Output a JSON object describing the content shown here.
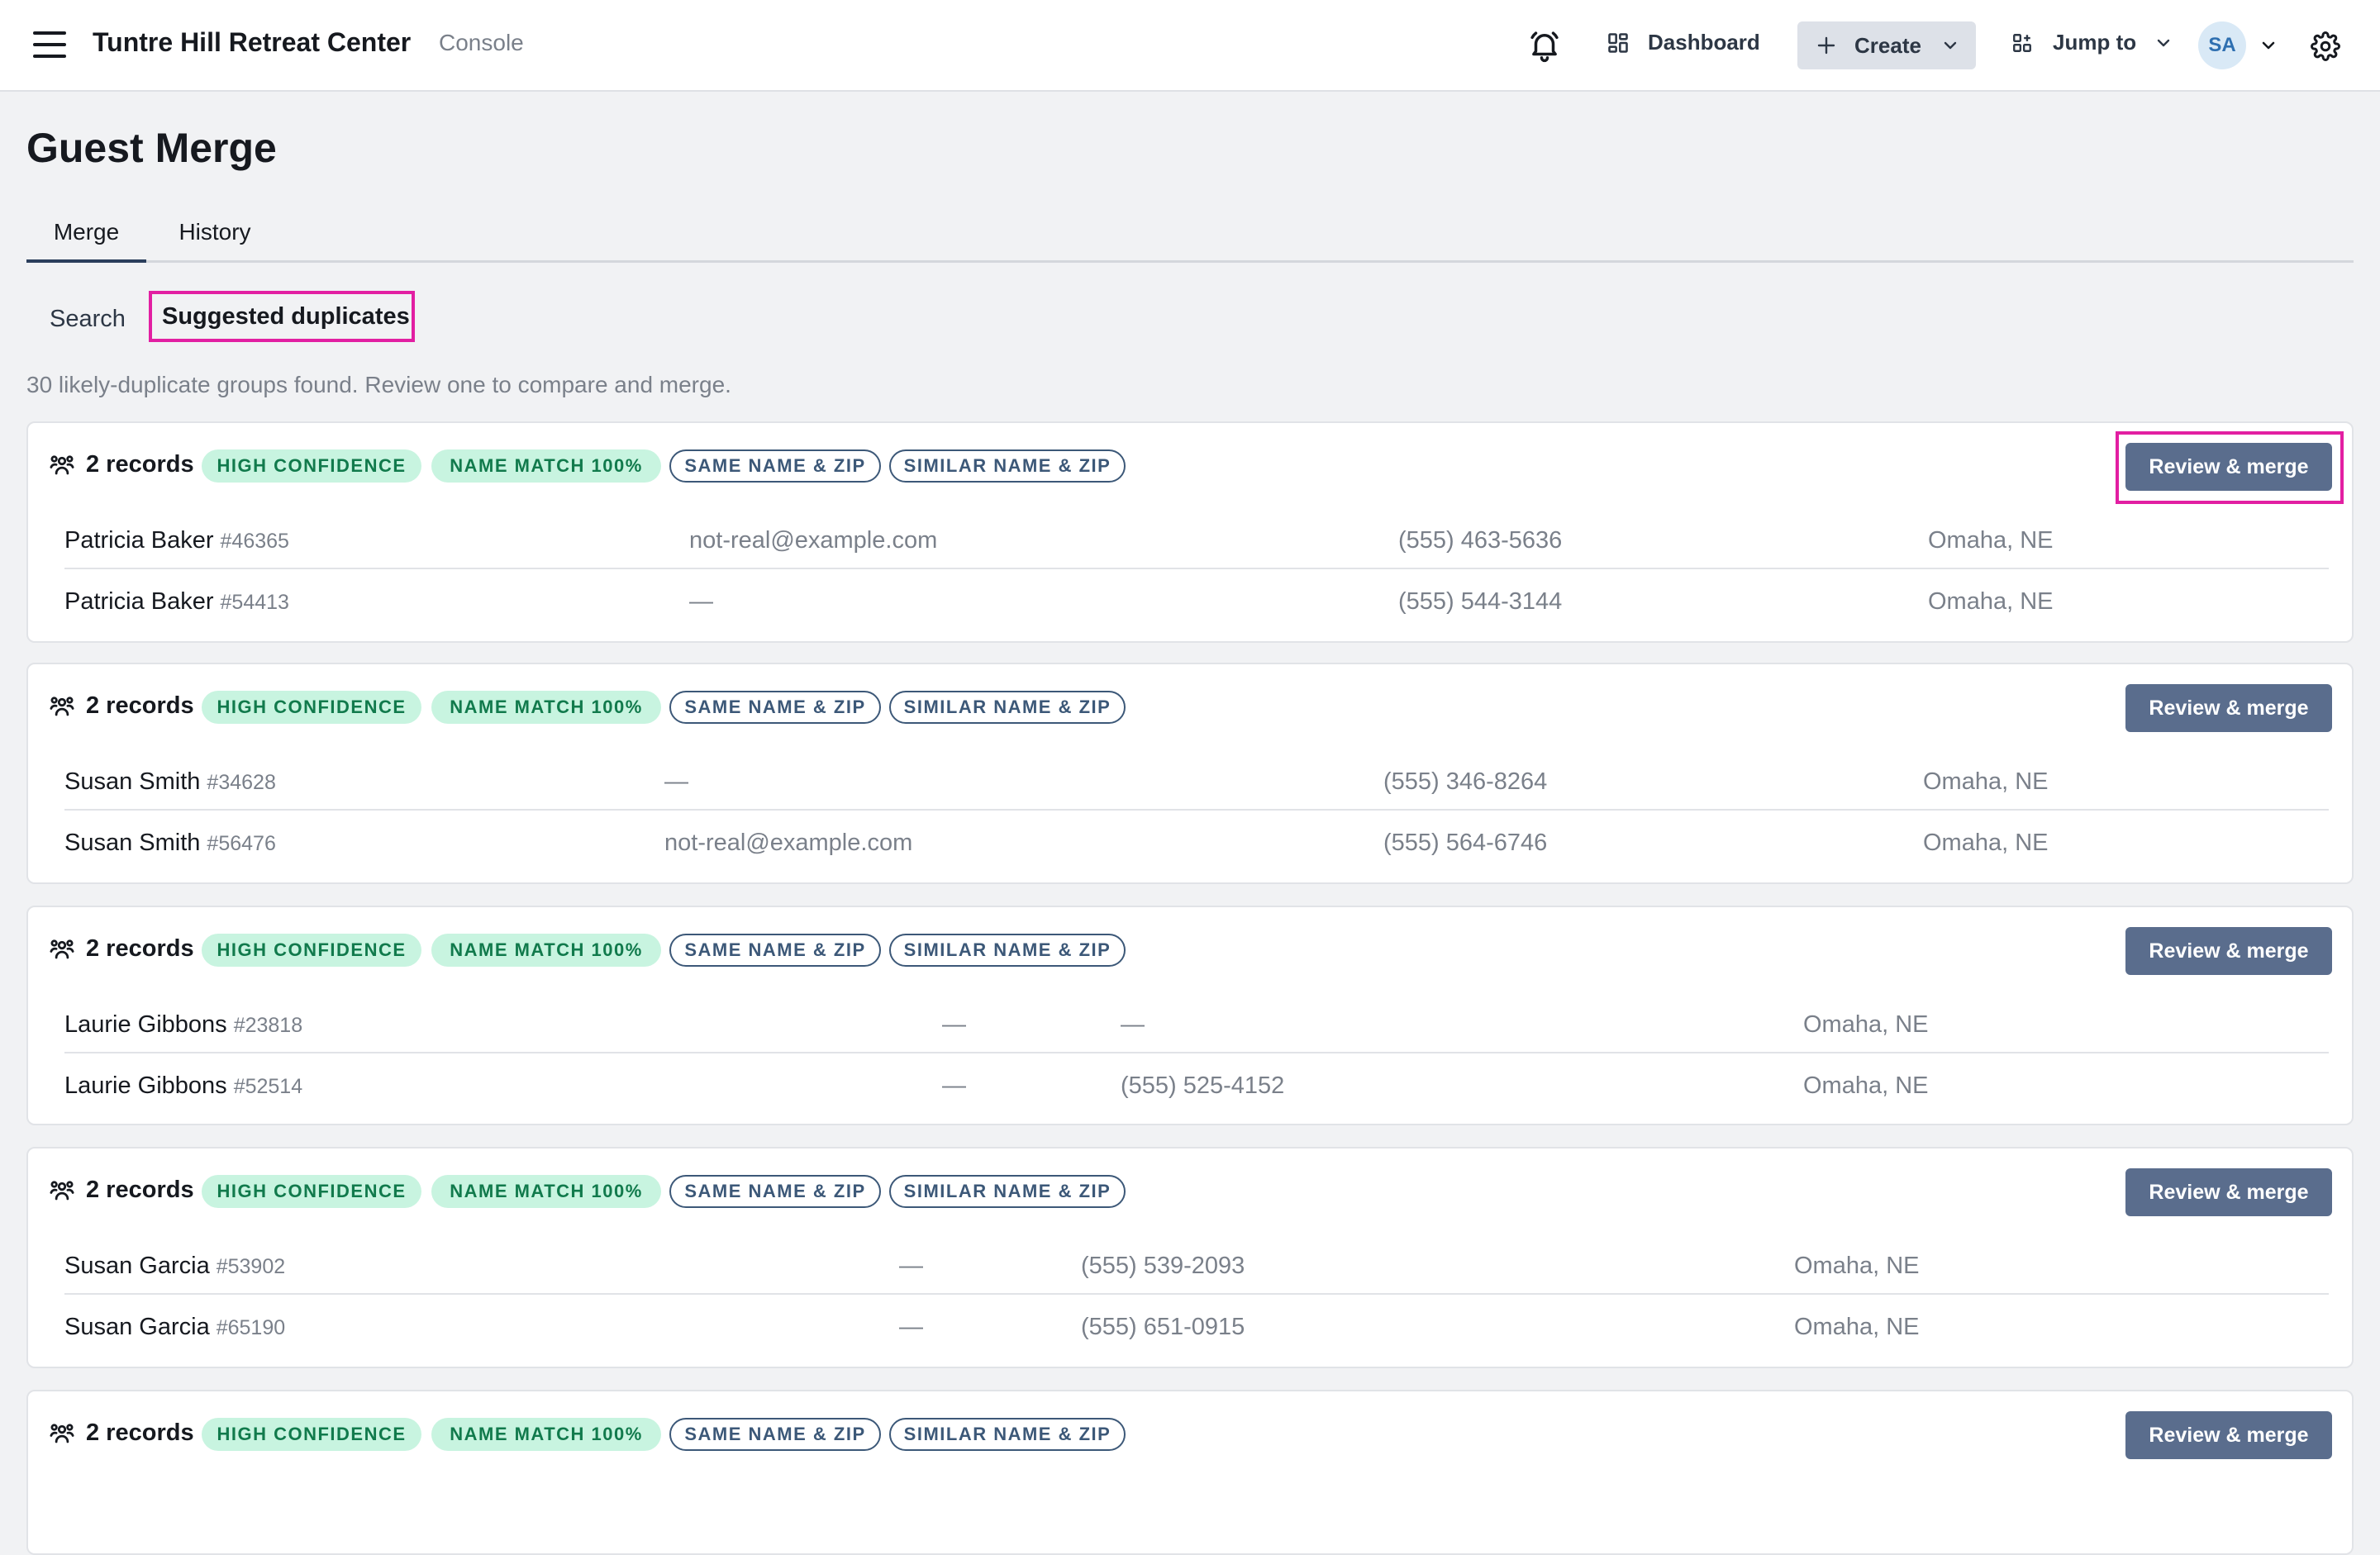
{
  "app": {
    "title": "Tuntre Hill Retreat Center",
    "subtitle": "Console"
  },
  "topbar": {
    "dashboard_label": "Dashboard",
    "create_label": "Create",
    "jump_label": "Jump to",
    "avatar_initials": "SA",
    "icons": [
      "menu-icon",
      "bell-icon",
      "dashboard-icon",
      "plus-icon",
      "chevron-down-icon",
      "jump-icon",
      "settings-icon"
    ]
  },
  "page": {
    "title": "Guest Merge",
    "tabs": [
      {
        "label": "Merge",
        "active": true
      },
      {
        "label": "History",
        "active": false
      }
    ],
    "subtabs": [
      {
        "label": "Search",
        "active": false
      },
      {
        "label": "Suggested duplicates",
        "active": true
      }
    ],
    "summary": "30 likely-duplicate groups found. Review one to compare and merge."
  },
  "groups": [
    {
      "count_label": "2 records",
      "badges": [
        "HIGH CONFIDENCE",
        "NAME MATCH 100%",
        "SAME NAME & ZIP",
        "SIMILAR NAME & ZIP"
      ],
      "action_label": "Review & merge",
      "records": [
        {
          "name": "Patricia Baker",
          "id": "#46365",
          "email": "not-real@example.com",
          "phone": "(555) 463-5636",
          "location": "Omaha, NE"
        },
        {
          "name": "Patricia Baker",
          "id": "#54413",
          "email": "—",
          "phone": "(555) 544-3144",
          "location": "Omaha, NE"
        }
      ]
    },
    {
      "count_label": "2 records",
      "badges": [
        "HIGH CONFIDENCE",
        "NAME MATCH 100%",
        "SAME NAME & ZIP",
        "SIMILAR NAME & ZIP"
      ],
      "action_label": "Review & merge",
      "records": [
        {
          "name": "Susan Smith",
          "id": "#34628",
          "email": "—",
          "phone": "(555) 346-8264",
          "location": "Omaha, NE"
        },
        {
          "name": "Susan Smith",
          "id": "#56476",
          "email": "not-real@example.com",
          "phone": "(555) 564-6746",
          "location": "Omaha, NE"
        }
      ]
    },
    {
      "count_label": "2 records",
      "badges": [
        "HIGH CONFIDENCE",
        "NAME MATCH 100%",
        "SAME NAME & ZIP",
        "SIMILAR NAME & ZIP"
      ],
      "action_label": "Review & merge",
      "records": [
        {
          "name": "Laurie Gibbons",
          "id": "#23818",
          "email": "—",
          "phone": "—",
          "location": "Omaha, NE"
        },
        {
          "name": "Laurie Gibbons",
          "id": "#52514",
          "email": "—",
          "phone": "(555) 525-4152",
          "location": "Omaha, NE"
        }
      ]
    },
    {
      "count_label": "2 records",
      "badges": [
        "HIGH CONFIDENCE",
        "NAME MATCH 100%",
        "SAME NAME & ZIP",
        "SIMILAR NAME & ZIP"
      ],
      "action_label": "Review & merge",
      "records": [
        {
          "name": "Susan Garcia",
          "id": "#53902",
          "email": "—",
          "phone": "(555) 539-2093",
          "location": "Omaha, NE"
        },
        {
          "name": "Susan Garcia",
          "id": "#65190",
          "email": "—",
          "phone": "(555) 651-0915",
          "location": "Omaha, NE"
        }
      ]
    },
    {
      "count_label": "2 records",
      "badges": [
        "HIGH CONFIDENCE",
        "NAME MATCH 100%",
        "SAME NAME & ZIP",
        "SIMILAR NAME & ZIP"
      ],
      "action_label": "Review & merge",
      "records": []
    }
  ],
  "colors": {
    "accent": "#5a6d8d",
    "highlight": "#e21fa2",
    "badge_green_bg": "#c8f4e0",
    "badge_green_text": "#117a4c",
    "badge_outline": "#3c5878"
  }
}
